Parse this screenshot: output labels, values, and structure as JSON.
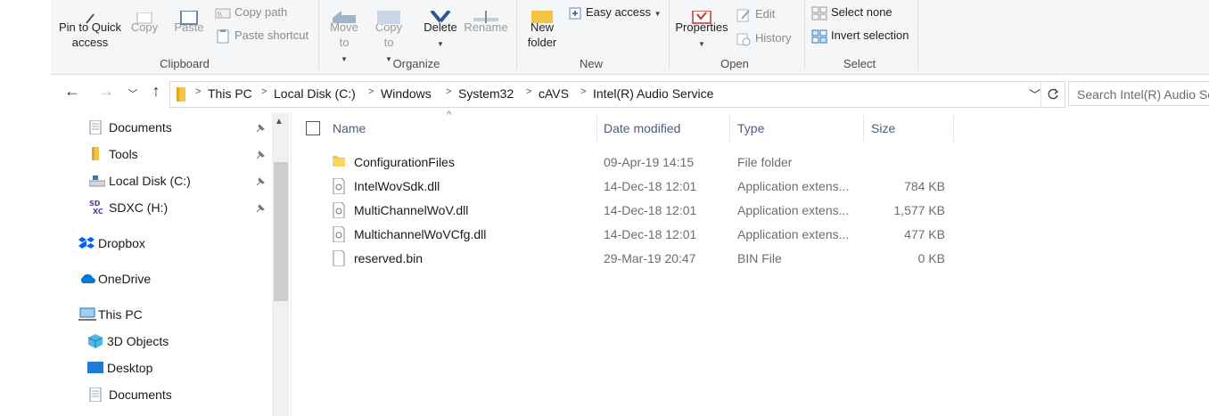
{
  "ribbon": {
    "clipboard": {
      "label": "Clipboard",
      "pin_quick_access": "Pin to Quick access",
      "copy": "Copy",
      "paste": "Paste",
      "copy_path": "Copy path",
      "paste_shortcut": "Paste shortcut"
    },
    "organize": {
      "label": "Organize",
      "move_to": "Move to",
      "copy_to": "Copy to",
      "delete": "Delete",
      "rename": "Rename"
    },
    "new": {
      "label": "New",
      "new_folder": "New folder",
      "easy_access": "Easy access"
    },
    "open": {
      "label": "Open",
      "properties": "Properties",
      "edit": "Edit",
      "history": "History"
    },
    "select": {
      "label": "Select",
      "select_none": "Select none",
      "invert_selection": "Invert selection"
    }
  },
  "address": {
    "breadcrumbs": [
      "This PC",
      "Local Disk (C:)",
      "Windows",
      "System32",
      "cAVS",
      "Intel(R) Audio Service"
    ],
    "search_placeholder": "Search Intel(R) Audio Service"
  },
  "nav": {
    "items": [
      {
        "label": "Documents",
        "icon": "documents-icon",
        "pinned": true
      },
      {
        "label": "Tools",
        "icon": "folder-icon",
        "pinned": true
      },
      {
        "label": "Local Disk (C:)",
        "icon": "drive-icon",
        "pinned": true
      },
      {
        "label": "SDXC (H:)",
        "icon": "sd-card-icon",
        "pinned": true
      },
      {
        "label": "Dropbox",
        "icon": "dropbox-icon"
      },
      {
        "label": "OneDrive",
        "icon": "onedrive-icon"
      },
      {
        "label": "This PC",
        "icon": "this-pc-icon"
      },
      {
        "label": "3D Objects",
        "icon": "3d-objects-icon"
      },
      {
        "label": "Desktop",
        "icon": "desktop-icon"
      },
      {
        "label": "Documents",
        "icon": "documents-icon"
      }
    ]
  },
  "filelist": {
    "columns": {
      "name": "Name",
      "date": "Date modified",
      "type": "Type",
      "size": "Size"
    },
    "rows": [
      {
        "name": "ConfigurationFiles",
        "date": "09-Apr-19 14:15",
        "type": "File folder",
        "size": "",
        "icon": "folder-icon"
      },
      {
        "name": "IntelWovSdk.dll",
        "date": "14-Dec-18 12:01",
        "type": "Application extens...",
        "size": "784 KB",
        "icon": "dll-file-icon"
      },
      {
        "name": "MultiChannelWoV.dll",
        "date": "14-Dec-18 12:01",
        "type": "Application extens...",
        "size": "1,577 KB",
        "icon": "dll-file-icon"
      },
      {
        "name": "MultichannelWoVCfg.dll",
        "date": "14-Dec-18 12:01",
        "type": "Application extens...",
        "size": "477 KB",
        "icon": "dll-file-icon"
      },
      {
        "name": "reserved.bin",
        "date": "29-Mar-19 20:47",
        "type": "BIN File",
        "size": "0 KB",
        "icon": "file-icon"
      }
    ]
  },
  "colors": {
    "accent": "#0078d7",
    "folder": "#f3c442",
    "header_text": "#4c607a"
  }
}
